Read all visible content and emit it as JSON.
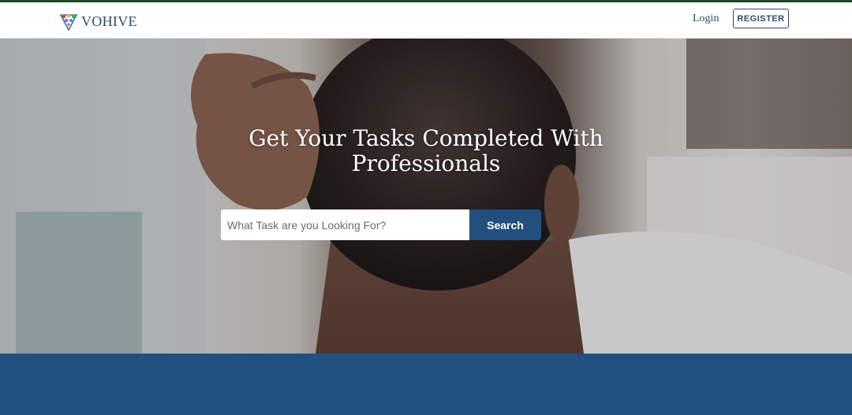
{
  "brand": {
    "name": "VOHIVE",
    "logo_icon": "triangle-logo-icon"
  },
  "nav": {
    "login_label": "Login",
    "register_label": "REGISTER"
  },
  "hero": {
    "title": "Get Your Tasks Completed With Professionals"
  },
  "search": {
    "placeholder": "What Task are you Looking For?",
    "value": "",
    "button_label": "Search"
  },
  "colors": {
    "primary": "#224f7e",
    "band": "#21507e",
    "text_dark": "#2d4a6b",
    "top_rule": "#1f4a2a"
  }
}
